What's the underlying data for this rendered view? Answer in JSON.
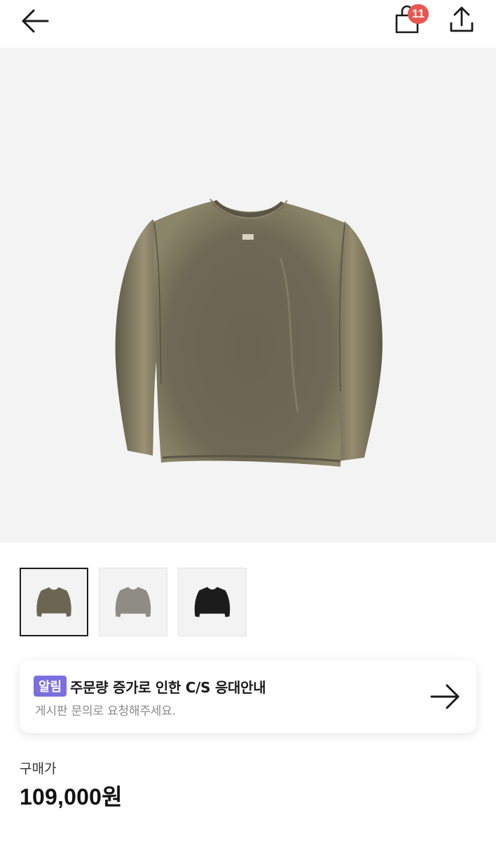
{
  "header": {
    "back_icon": "arrow-left-icon",
    "cart_icon": "shopping-bag-icon",
    "cart_count": "11",
    "share_icon": "share-icon"
  },
  "product": {
    "main_image": "olive-brown washed crewneck sweatshirt",
    "thumbnails": [
      {
        "color": "#6b6552",
        "selected": true
      },
      {
        "color": "#8f8c85",
        "selected": false
      },
      {
        "color": "#1c1c1c",
        "selected": false
      }
    ]
  },
  "notice": {
    "tag": "알림",
    "title": "주문량 증가로 인한 C/S 응대안내",
    "subtitle": "게시판 문의로 요청해주세요.",
    "arrow_icon": "arrow-right-icon"
  },
  "price": {
    "label": "구매가",
    "value": "109,000원"
  },
  "colors": {
    "badge": "#e8574f",
    "tag": "#7b6fe0",
    "image_bg": "#f3f3f3"
  }
}
